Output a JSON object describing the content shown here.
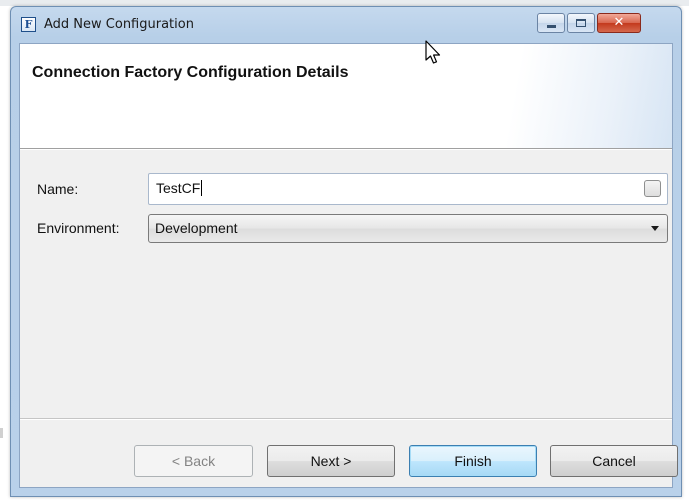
{
  "window": {
    "title": "Add New Configuration",
    "app_icon_letter": "F",
    "controls": {
      "minimize_icon": "minimize-icon",
      "maximize_icon": "maximize-icon",
      "close_icon": "close-icon",
      "close_glyph": "✕"
    }
  },
  "banner": {
    "title": "Connection Factory Configuration Details"
  },
  "form": {
    "name": {
      "label": "Name:",
      "value": "TestCF"
    },
    "environment": {
      "label": "Environment:",
      "selected": "Development"
    }
  },
  "buttons": {
    "back": "< Back",
    "next": "Next >",
    "finish": "Finish",
    "cancel": "Cancel"
  },
  "colors": {
    "window_frame": "#b9d1ea",
    "close_button": "#c3391d",
    "default_button_border": "#3c7fb1"
  }
}
